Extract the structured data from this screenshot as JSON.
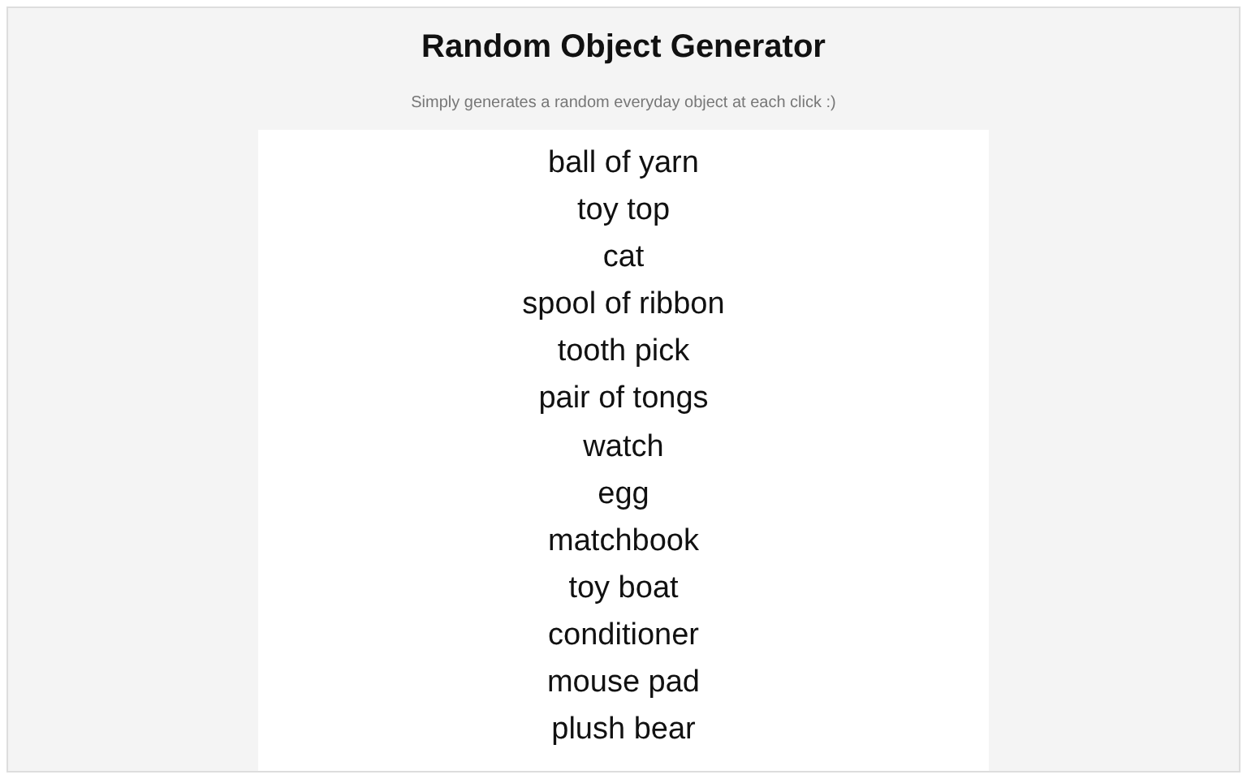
{
  "title": "Random Object Generator",
  "subtitle": "Simply generates a random everyday object at each click :)",
  "objects": [
    "ball of yarn",
    "toy top",
    "cat",
    "spool of ribbon",
    "tooth pick",
    "pair of tongs",
    "watch",
    "egg",
    "matchbook",
    "toy boat",
    "conditioner",
    "mouse pad",
    "plush bear"
  ]
}
